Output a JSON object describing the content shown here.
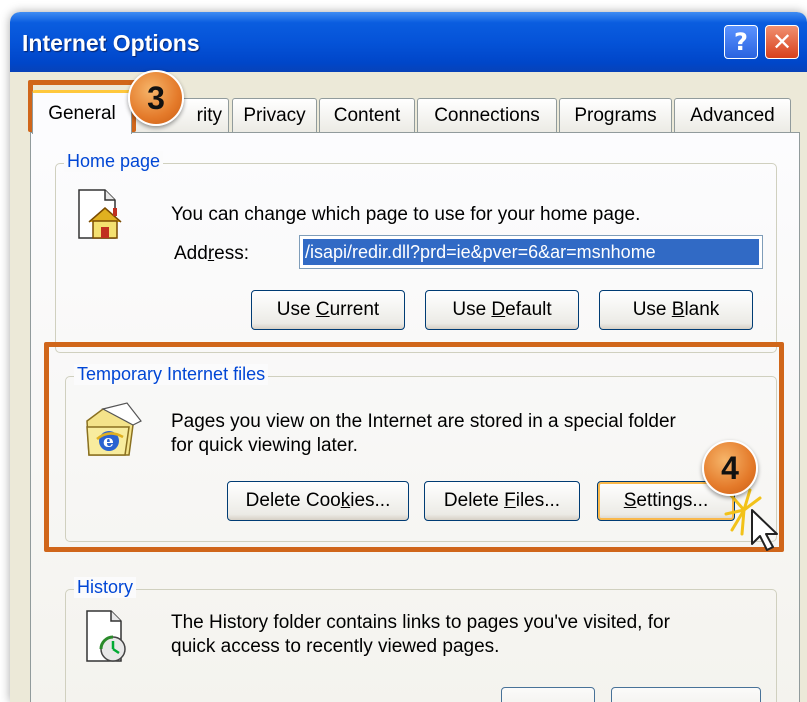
{
  "window": {
    "title": "Internet Options",
    "help_label": "?",
    "close_label": "✕"
  },
  "tabs": [
    {
      "label": "General",
      "active": true
    },
    {
      "label": "Security"
    },
    {
      "label": "Privacy"
    },
    {
      "label": "Content"
    },
    {
      "label": "Connections"
    },
    {
      "label": "Programs"
    },
    {
      "label": "Advanced"
    }
  ],
  "tab_visible_fragment": "rity",
  "home_page": {
    "group_label": "Home page",
    "description": "You can change which page to use for your home page.",
    "address_label": "Address:",
    "address_value": "/isapi/redir.dll?prd=ie&pver=6&ar=msnhome",
    "buttons": {
      "use_current": "Use Current",
      "use_default": "Use Default",
      "use_blank": "Use Blank"
    }
  },
  "temp_files": {
    "group_label": "Temporary Internet files",
    "description_line1": "Pages you view on the Internet are stored in a special folder",
    "description_line2": "for quick viewing later.",
    "buttons": {
      "delete_cookies": "Delete Cookies...",
      "delete_files": "Delete Files...",
      "settings": "Settings..."
    }
  },
  "history": {
    "group_label": "History",
    "description_line1": "The History folder contains links to pages you've visited, for",
    "description_line2": "quick access to recently viewed pages."
  },
  "callouts": {
    "step3": "3",
    "step4": "4"
  },
  "colors": {
    "accent_orange": "#d0661a",
    "group_label_blue": "#0046d5",
    "selection_blue": "#316ac5"
  }
}
